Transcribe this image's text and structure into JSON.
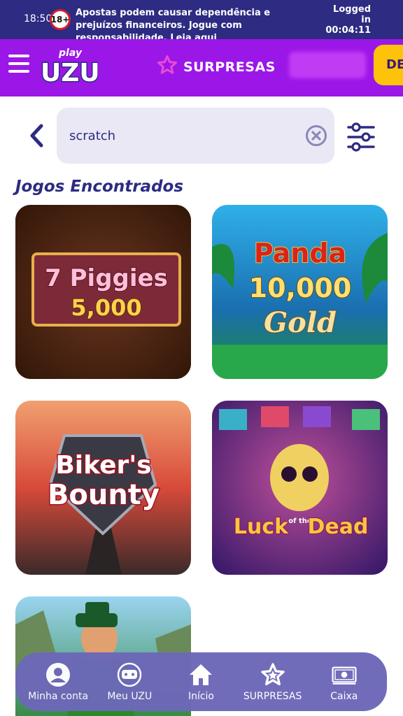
{
  "status": {
    "time": "18:50",
    "age_badge": "18+",
    "warning_text": "Apostas podem causar dependência e prejuízos financeiros. Jogue com responsabilidade.",
    "warning_link": "Leia aqui",
    "logged_label": "Logged in",
    "session_timer": "00:04:11"
  },
  "header": {
    "logo_top": "play",
    "logo_main": "UZU",
    "surpresas_label": "SURPRESAS",
    "deposit_label": "DE"
  },
  "search": {
    "value": "scratch",
    "placeholder": ""
  },
  "results": {
    "title": "Jogos Encontrados",
    "games": [
      {
        "name_line1": "7 Piggies",
        "name_line2": "5,000"
      },
      {
        "name_line1": "Panda",
        "name_line2": "10,000",
        "name_line3": "Gold"
      },
      {
        "name_line1": "Biker's",
        "name_line2": "Bounty"
      },
      {
        "name_line1": "Luck",
        "name_line2": "of the",
        "name_line3": "Dead"
      },
      {
        "name_line1": "",
        "name_line2": ""
      }
    ]
  },
  "bottom_nav": {
    "items": [
      {
        "label": "Minha conta",
        "icon": "user-icon"
      },
      {
        "label": "Meu UZU",
        "icon": "uzu-icon"
      },
      {
        "label": "Início",
        "icon": "home-icon"
      },
      {
        "label": "SURPRESAS",
        "icon": "star-icon"
      },
      {
        "label": "Caixa",
        "icon": "cash-icon"
      }
    ]
  },
  "colors": {
    "status_bg": "#2d2b82",
    "header_bg": "#9b17e8",
    "deposit_btn": "#fdc30a",
    "accent_navy": "#2d2b82",
    "search_bg": "#e9e8f4",
    "nav_bg": "#6d68b8",
    "star_pink": "#e94bd5"
  }
}
